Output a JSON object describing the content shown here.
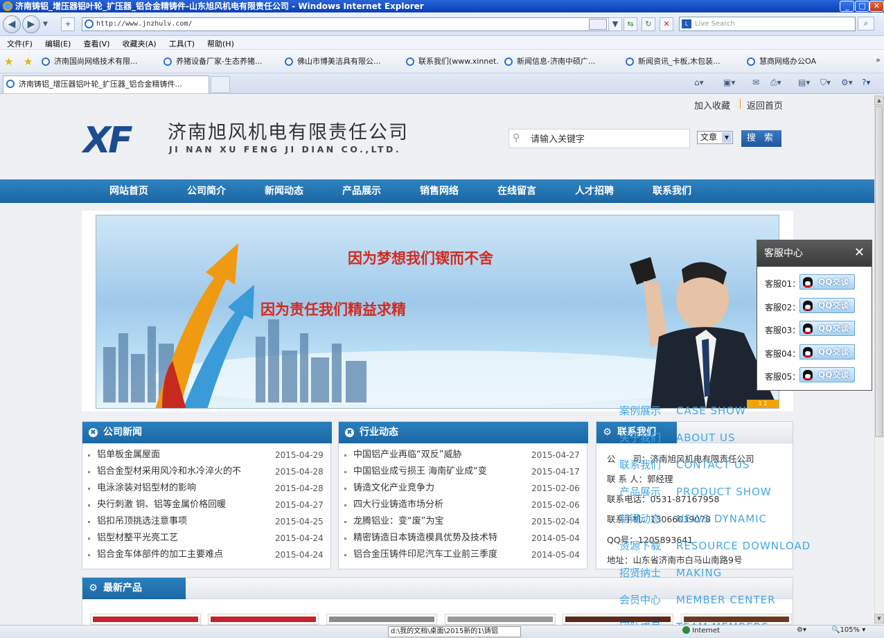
{
  "browser": {
    "title": "济南铸铝_增压器铝叶轮_扩压器_铝合金精铸件-山东旭风机电有限责任公司 - Windows Internet Explorer",
    "address": "http://www.jnzhulv.com/",
    "search_placeholder": "Live Search",
    "menu": [
      "文件(F)",
      "编辑(E)",
      "查看(V)",
      "收藏夹(A)",
      "工具(T)",
      "帮助(H)"
    ],
    "favorites": [
      "济南国尚网络技术有限...",
      "养猪设备厂家-生态养猪...",
      "佛山市博美洁具有限公...",
      "联系我们(www.xinnet...",
      "新闻信息-济南中硕广...",
      "新闻资讯_卡板,木包装...",
      "慧商网络办公OA"
    ],
    "tab_title": "济南铸铝_增压器铝叶轮_扩压器_铝合金精铸件...",
    "status_text": "d:\\我的文档\\桌面\\2015新的1\\铸铝",
    "status_zone": "Internet",
    "zoom": "105%"
  },
  "site": {
    "top_links": [
      "加入收藏",
      "返回首页"
    ],
    "logo_mark": "XF",
    "company_cn": "济南旭风机电有限责任公司",
    "company_en": "JI NAN XU FENG JI DIAN CO.,LTD.",
    "search_placeholder": "请输入关键字",
    "search_type": "文章",
    "search_button": "搜 索",
    "nav": [
      "网站首页",
      "公司简介",
      "新闻动态",
      "产品展示",
      "销售网络",
      "在线留言",
      "人才招聘",
      "联系我们"
    ],
    "banner": {
      "line1": "因为梦想我们锲而不舍",
      "line2": "因为责任我们精益求精",
      "dots": "1 2"
    },
    "company_news": {
      "title": "公司新闻",
      "items": [
        {
          "title": "铝单板金属屋面",
          "date": "2015-04-29"
        },
        {
          "title": "铝合金型材采用风冷和水冷淬火的不",
          "date": "2015-04-28"
        },
        {
          "title": "电泳涂装对铝型材的影响",
          "date": "2015-04-28"
        },
        {
          "title": "央行刺激 铜、铝等金属价格回暖",
          "date": "2015-04-27"
        },
        {
          "title": "铝扣吊顶挑选注意事项",
          "date": "2015-04-25"
        },
        {
          "title": "铝型材整平光亮工艺",
          "date": "2015-04-24"
        },
        {
          "title": "铝合金车体部件的加工主要难点",
          "date": "2015-04-24"
        }
      ]
    },
    "industry_news": {
      "title": "行业动态",
      "items": [
        {
          "title": "中国铝产业再临“双反”威胁",
          "date": "2015-04-27"
        },
        {
          "title": "中国铝业成亏损王 海南矿业成“变",
          "date": "2015-04-17"
        },
        {
          "title": "铸造文化产业竞争力",
          "date": "2015-02-06"
        },
        {
          "title": "四大行业铸造市场分析",
          "date": "2015-02-06"
        },
        {
          "title": "龙腾铝业：变“废”为宝",
          "date": "2015-02-04"
        },
        {
          "title": "精密铸造日本铸造模具优势及技术特",
          "date": "2014-05-04"
        },
        {
          "title": "铝合金压铸件印尼汽车工业前三季度",
          "date": "2014-05-04"
        }
      ]
    },
    "contact": {
      "title": "联系我们",
      "lines": [
        "公　　司：济南旭风机电有限责任公司",
        "联 系 人：郭经理",
        "联系电话：0531-87167958",
        "联系手机：13066039078",
        "QQ号：1205893641",
        "地址：山东省济南市白马山南路9号"
      ]
    },
    "products": {
      "title": "最新产品"
    },
    "float_menu": [
      {
        "cn": "案例展示",
        "en": "CASE SHOW"
      },
      {
        "cn": "关于我们",
        "en": "ABOUT US"
      },
      {
        "cn": "联系我们",
        "en": "CONTACT US"
      },
      {
        "cn": "产品展示",
        "en": "PRODUCT SHOW"
      },
      {
        "cn": "新闻动态",
        "en": "NEWS DYNAMIC"
      },
      {
        "cn": "资源下载",
        "en": "RESOURCE DOWNLOAD"
      },
      {
        "cn": "招贤纳士",
        "en": "MAKING"
      },
      {
        "cn": "会员中心",
        "en": "MEMBER CENTER"
      },
      {
        "cn": "团队成员",
        "en": "TEAM MEMBERS"
      }
    ],
    "kefu": {
      "title": "客服中心",
      "close": "✕",
      "items": [
        {
          "label": "客服01：",
          "button": "QQ交谈"
        },
        {
          "label": "客服02：",
          "button": "QQ交谈"
        },
        {
          "label": "客服03：",
          "button": "QQ交谈"
        },
        {
          "label": "客服04：",
          "button": "QQ交谈"
        },
        {
          "label": "客服05：",
          "button": "QQ交谈"
        }
      ]
    }
  }
}
